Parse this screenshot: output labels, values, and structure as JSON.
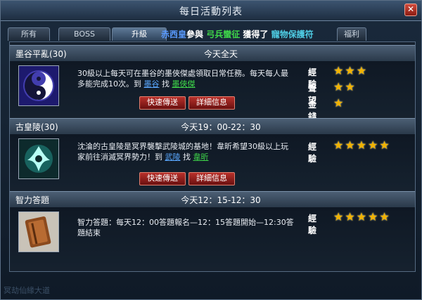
{
  "window": {
    "title": "每日活動列表",
    "close_label": "✕"
  },
  "tabs": [
    {
      "label": "所有"
    },
    {
      "label": "BOSS"
    },
    {
      "label": "升級"
    },
    {
      "label": "福利"
    }
  ],
  "marquee": {
    "part1": "赤西皇",
    "part2": "參與",
    "part3": "弓兵蠻征",
    "part4": "獲得了",
    "part5": "寵物保護符"
  },
  "events": [
    {
      "name": "墨谷平亂(30)",
      "time": "今天全天",
      "desc_text": "30級以上每天可在墨谷的墨俠傑處領取日常任務。每天每人最多能完成10次。到 ",
      "link1": "墨谷",
      "mid": " 找 ",
      "link2": "墨俠傑",
      "btn_teleport": "快速傳送",
      "btn_detail": "詳細信息",
      "rewards": [
        {
          "label": "經驗",
          "stars": "★★★"
        },
        {
          "label": "聲望",
          "stars": "★★"
        },
        {
          "label": "金錢",
          "stars": "★"
        }
      ]
    },
    {
      "name": "古皇陵(30)",
      "time": "今天19：00-22：30",
      "desc_text": "沈淪的古皇陵是冥界襲擊武陵城的基地！韋昕希望30級以上玩家前往消滅冥界勢力！到 ",
      "link1": "武陵",
      "mid": " 找 ",
      "link2": "韋昕",
      "btn_teleport": "快速傳送",
      "btn_detail": "詳細信息",
      "rewards": [
        {
          "label": "經驗",
          "stars": "★★★★★"
        }
      ]
    },
    {
      "name": "智力答題",
      "time": "今天12：15-12：30",
      "desc_text": "智力答題：每天12：00答題報名—12：15答題開始—12:30答題結束",
      "rewards": [
        {
          "label": "經驗",
          "stars": "★★★★★"
        }
      ]
    }
  ],
  "footer": {
    "text": "冥劫仙緣大道"
  },
  "colors": {
    "accent": "#f2b300",
    "link": "#5aa8ff",
    "button": "#b8302a"
  }
}
